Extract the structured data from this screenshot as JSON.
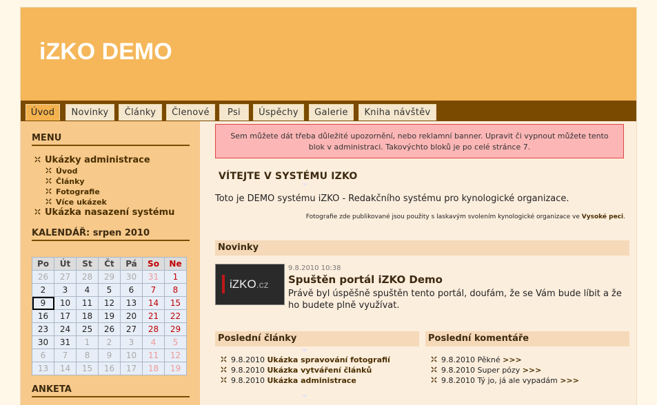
{
  "site": {
    "title": "iZKO DEMO"
  },
  "nav": {
    "tabs": [
      "Úvod",
      "Novinky",
      "Články",
      "Členové",
      "Psi",
      "Úspěchy",
      "Galerie",
      "Kniha návštěv"
    ],
    "active": "Úvod"
  },
  "sidebar": {
    "menu_heading": "MENU",
    "menu": [
      {
        "label": "Ukázky administrace",
        "children": [
          "Úvod",
          "Články",
          "Fotografie",
          "Více ukázek"
        ]
      },
      {
        "label": "Ukázka nasazení systému",
        "children": []
      }
    ],
    "calendar": {
      "heading": "KALENDÁŘ: srpen 2010",
      "headers": [
        "Po",
        "Út",
        "St",
        "Čt",
        "Pá",
        "So",
        "Ne"
      ],
      "weeks": [
        [
          "26",
          "27",
          "28",
          "29",
          "30",
          "31",
          "1"
        ],
        [
          "2",
          "3",
          "4",
          "5",
          "6",
          "7",
          "8"
        ],
        [
          "9",
          "10",
          "11",
          "12",
          "13",
          "14",
          "15"
        ],
        [
          "16",
          "17",
          "18",
          "19",
          "20",
          "21",
          "22"
        ],
        [
          "23",
          "24",
          "25",
          "26",
          "27",
          "28",
          "29"
        ],
        [
          "30",
          "31",
          "1",
          "2",
          "3",
          "4",
          "5"
        ],
        [
          "6",
          "7",
          "8",
          "9",
          "10",
          "11",
          "12"
        ],
        [
          "13",
          "14",
          "15",
          "16",
          "17",
          "18",
          "19"
        ]
      ],
      "today": "9"
    },
    "poll_heading": "ANKETA"
  },
  "main": {
    "notice": "Sem můžete dát třeba důležité upozornění, nebo reklamní banner. Upravit či vypnout můžete tento blok v administraci. Takovýchto bloků je po celé stránce 7.",
    "welcome": "VÍTEJTE V SYSTÉMU IZKO",
    "intro": "Toto je DEMO systému iZKO - Redakčního systému pro kynologické organizace.",
    "credit_text": "Fotografie zde publikované jsou použity s laskavým svolením kynologické organizace ve",
    "credit_link": "Vysoké peci",
    "credit_end": ".",
    "news": {
      "heading": "Novinky",
      "logo_main": "iZKO",
      "logo_suffix": ".cz",
      "date": "9.8.2010 10:38",
      "title": "Spuštěn portál iZKO Demo",
      "text": "Právě byl úspěšně spuštěn tento portál, doufám, že se Vám bude líbit a že ho budete plně využívat."
    },
    "articles": {
      "heading": "Poslední články",
      "items": [
        {
          "date": "9.8.2010",
          "title": "Ukázka spravování fotografií"
        },
        {
          "date": "9.8.2010",
          "title": "Ukázka vytváření článků"
        },
        {
          "date": "9.8.2010",
          "title": "Ukázka administrace"
        }
      ]
    },
    "comments": {
      "heading": "Poslední komentáře",
      "items": [
        {
          "text": "9.8.2010 Pěkné",
          "more": ">>>"
        },
        {
          "text": "9.8.2010 Super pózy",
          "more": ">>>"
        },
        {
          "text": "9.8.2010 Tý jo, já ale vypadám",
          "more": ">>>"
        }
      ]
    }
  },
  "colors": {
    "header": "#f5b75a",
    "nav": "#7a4a00",
    "sidebar": "#f7c98a",
    "content": "#fceedd",
    "accent": "#4a2f00",
    "weekend": "#c00000"
  }
}
